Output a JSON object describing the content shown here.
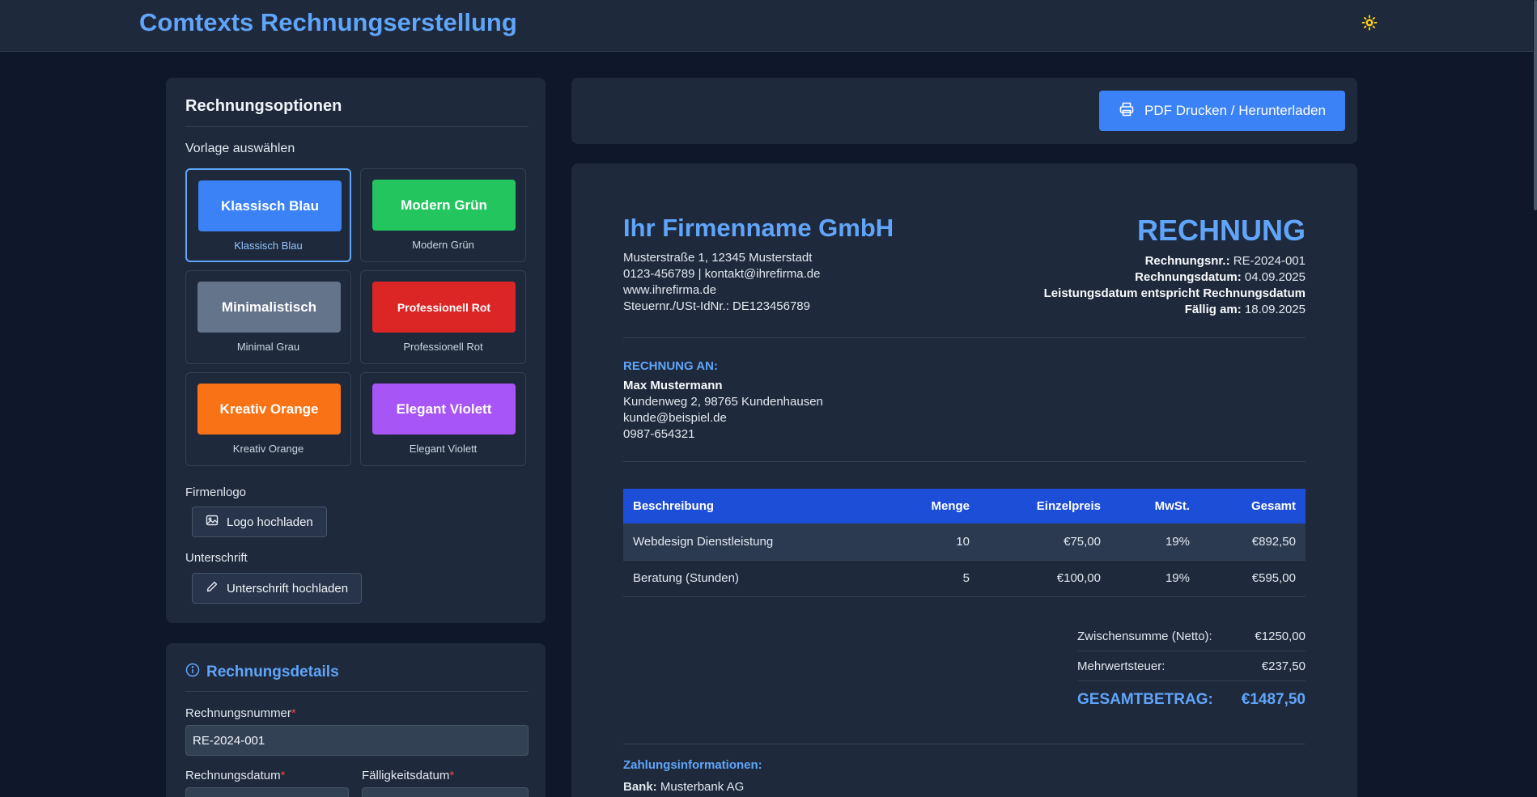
{
  "app": {
    "title": "Comtexts Rechnungserstellung",
    "theme_icon": "sun-icon"
  },
  "options": {
    "heading": "Rechnungsoptionen",
    "template_label": "Vorlage auswählen",
    "templates": [
      {
        "swatch": "Klassisch Blau",
        "label": "Klassisch Blau",
        "color": "#3b82f6",
        "selected": true
      },
      {
        "swatch": "Modern Grün",
        "label": "Modern Grün",
        "color": "#22c55e"
      },
      {
        "swatch": "Minimalistisch",
        "label": "Minimal Grau",
        "color": "#64748b"
      },
      {
        "swatch": "Professionell Rot",
        "label": "Professionell Rot",
        "color": "#dc2626"
      },
      {
        "swatch": "Kreativ Orange",
        "label": "Kreativ Orange",
        "color": "#f97316"
      },
      {
        "swatch": "Elegant Violett",
        "label": "Elegant Violett",
        "color": "#a855f7"
      }
    ],
    "logo_label": "Firmenlogo",
    "logo_button": "Logo hochladen",
    "signature_label": "Unterschrift",
    "signature_button": "Unterschrift hochladen"
  },
  "details": {
    "heading": "Rechnungsdetails",
    "invoice_number_label": "Rechnungsnummer",
    "invoice_number_value": "RE-2024-001",
    "invoice_date_label": "Rechnungsdatum",
    "due_date_label": "Fälligkeitsdatum",
    "required_marker": "*"
  },
  "actions": {
    "pdf_button": "PDF Drucken / Herunterladen"
  },
  "invoice": {
    "company": {
      "name": "Ihr Firmenname GmbH",
      "address": "Musterstraße 1, 12345 Musterstadt",
      "contact": "0123-456789 | kontakt@ihrefirma.de",
      "website": "www.ihrefirma.de",
      "tax": "Steuernr./USt-IdNr.: DE123456789"
    },
    "title": "RECHNUNG",
    "meta": {
      "number_label": "Rechnungsnr.:",
      "number": "RE-2024-001",
      "date_label": "Rechnungsdatum:",
      "date": "04.09.2025",
      "service_note": "Leistungsdatum entspricht Rechnungsdatum",
      "due_label": "Fällig am:",
      "due": "18.09.2025"
    },
    "bill_to_label": "RECHNUNG AN:",
    "customer": {
      "name": "Max Mustermann",
      "address": "Kundenweg 2, 98765 Kundenhausen",
      "email": "kunde@beispiel.de",
      "phone": "0987-654321"
    },
    "table": {
      "headers": [
        "Beschreibung",
        "Menge",
        "Einzelpreis",
        "MwSt.",
        "Gesamt"
      ],
      "rows": [
        [
          "Webdesign Dienstleistung",
          "10",
          "€75,00",
          "19%",
          "€892,50"
        ],
        [
          "Beratung (Stunden)",
          "5",
          "€100,00",
          "19%",
          "€595,00"
        ]
      ]
    },
    "totals": {
      "subtotal_label": "Zwischensumme (Netto):",
      "subtotal": "€1250,00",
      "vat_label": "Mehrwertsteuer:",
      "vat": "€237,50",
      "grand_label": "GESAMTBETRAG:",
      "grand": "€1487,50"
    },
    "payment_label": "Zahlungsinformationen:",
    "bank_label": "Bank:",
    "bank": "Musterbank AG"
  }
}
